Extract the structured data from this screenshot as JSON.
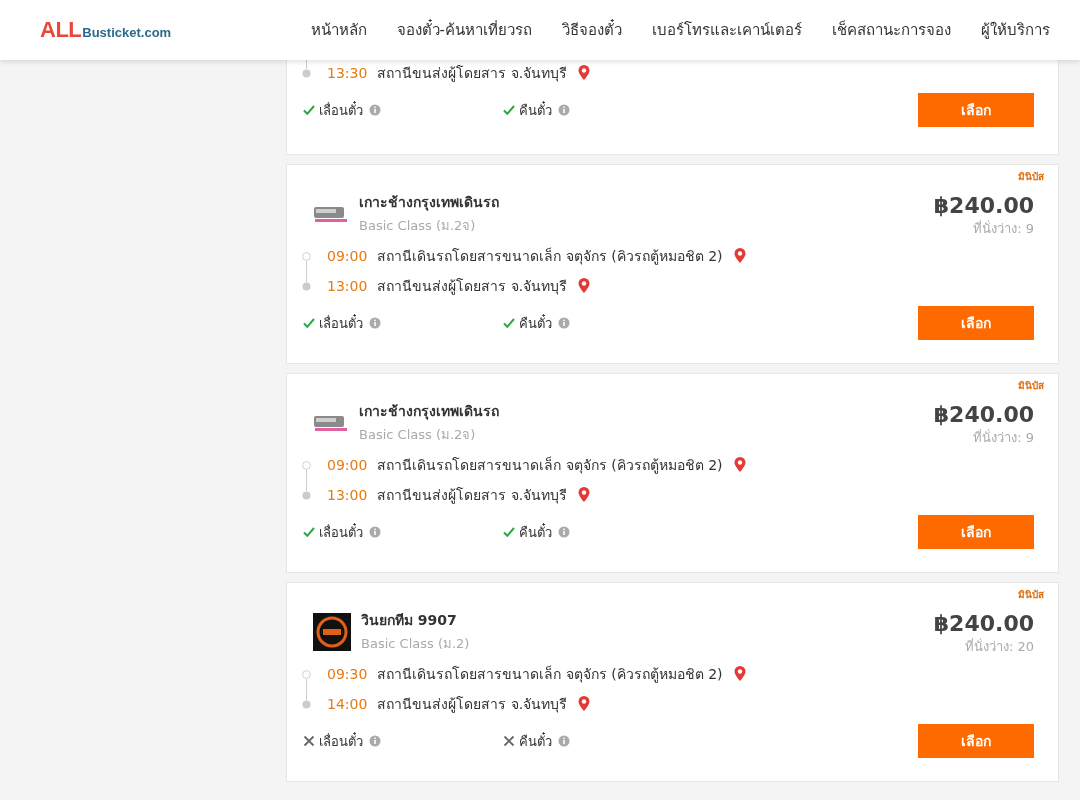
{
  "header": {
    "logo_main": "ALL",
    "logo_sub": "Busticket.com",
    "nav": [
      {
        "label": "หน้าหลัก"
      },
      {
        "label": "จองตั๋ว-ค้นหาเที่ยวรถ"
      },
      {
        "label": "วิธีจองตั๋ว"
      },
      {
        "label": "เบอร์โทรและเคาน์เตอร์"
      },
      {
        "label": "เช็คสถานะการจอง"
      },
      {
        "label": "ผู้ให้บริการ"
      }
    ]
  },
  "trips": [
    {
      "stops": [
        {
          "time": "13:30",
          "place": "สถานีขนส่งผู้โดยสาร จ.จันทบุรี",
          "kind": "arrive"
        }
      ],
      "features": [
        {
          "label": "เลื่อนตั๋ว",
          "available": true
        },
        {
          "label": "คืนตั๋ว",
          "available": true
        }
      ],
      "button": "เลือก"
    },
    {
      "badge": "มินิบัส",
      "logo": {
        "kind": "bus"
      },
      "operator": "เกาะช้างกรุงเทพเดินรถ",
      "class": "Basic Class (ม.2จ)",
      "price": "฿240.00",
      "seats": "ที่นั่งว่าง: 9",
      "stops": [
        {
          "time": "09:00",
          "place": "สถานีเดินรถโดยสารขนาดเล็ก จตุจักร (คิวรถตู้หมอชิต 2)",
          "kind": "depart"
        },
        {
          "time": "13:00",
          "place": "สถานีขนส่งผู้โดยสาร จ.จันทบุรี",
          "kind": "arrive"
        }
      ],
      "features": [
        {
          "label": "เลื่อนตั๋ว",
          "available": true
        },
        {
          "label": "คืนตั๋ว",
          "available": true
        }
      ],
      "button": "เลือก"
    },
    {
      "badge": "มินิบัส",
      "logo": {
        "kind": "bus"
      },
      "operator": "เกาะช้างกรุงเทพเดินรถ",
      "class": "Basic Class (ม.2จ)",
      "price": "฿240.00",
      "seats": "ที่นั่งว่าง: 9",
      "stops": [
        {
          "time": "09:00",
          "place": "สถานีเดินรถโดยสารขนาดเล็ก จตุจักร (คิวรถตู้หมอชิต 2)",
          "kind": "depart"
        },
        {
          "time": "13:00",
          "place": "สถานีขนส่งผู้โดยสาร จ.จันทบุรี",
          "kind": "arrive"
        }
      ],
      "features": [
        {
          "label": "เลื่อนตั๋ว",
          "available": true
        },
        {
          "label": "คืนตั๋ว",
          "available": true
        }
      ],
      "button": "เลือก"
    },
    {
      "badge": "มินิบัส",
      "logo": {
        "kind": "emblem"
      },
      "operator": "วินยกทีม 9907",
      "class": "Basic Class (ม.2)",
      "price": "฿240.00",
      "seats": "ที่นั่งว่าง: 20",
      "stops": [
        {
          "time": "09:30",
          "place": "สถานีเดินรถโดยสารขนาดเล็ก จตุจักร (คิวรถตู้หมอชิต 2)",
          "kind": "depart"
        },
        {
          "time": "14:00",
          "place": "สถานีขนส่งผู้โดยสาร จ.จันทบุรี",
          "kind": "arrive"
        }
      ],
      "features": [
        {
          "label": "เลื่อนตั๋ว",
          "available": false
        },
        {
          "label": "คืนตั๋ว",
          "available": false
        }
      ],
      "button": "เลือก"
    }
  ]
}
